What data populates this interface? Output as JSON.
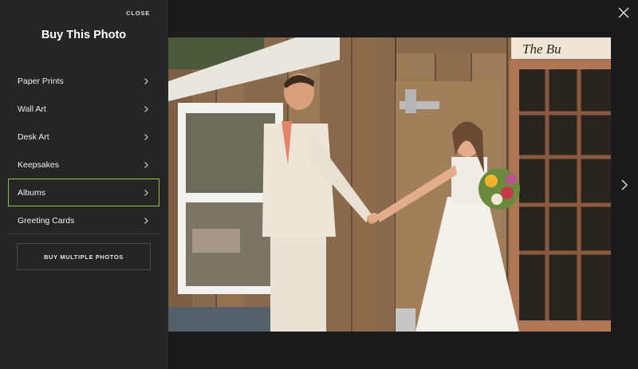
{
  "panel": {
    "close_label": "CLOSE",
    "title": "Buy This Photo",
    "items": [
      {
        "label": "Paper Prints"
      },
      {
        "label": "Wall Art"
      },
      {
        "label": "Desk Art"
      },
      {
        "label": "Keepsakes"
      },
      {
        "label": "Albums",
        "active": true
      },
      {
        "label": "Greeting Cards"
      }
    ],
    "buy_multiple_label": "BUY MULTIPLE PHOTOS",
    "chevron_icon": "chevron-right-icon"
  },
  "viewer": {
    "close_icon": "close-icon",
    "next_icon": "chevron-right-icon",
    "photo_subject": "photo",
    "sign_text": "The Bu"
  },
  "colors": {
    "panel_bg": "#252526",
    "page_bg": "#1b1b1c",
    "accent": "#8bc34a"
  }
}
